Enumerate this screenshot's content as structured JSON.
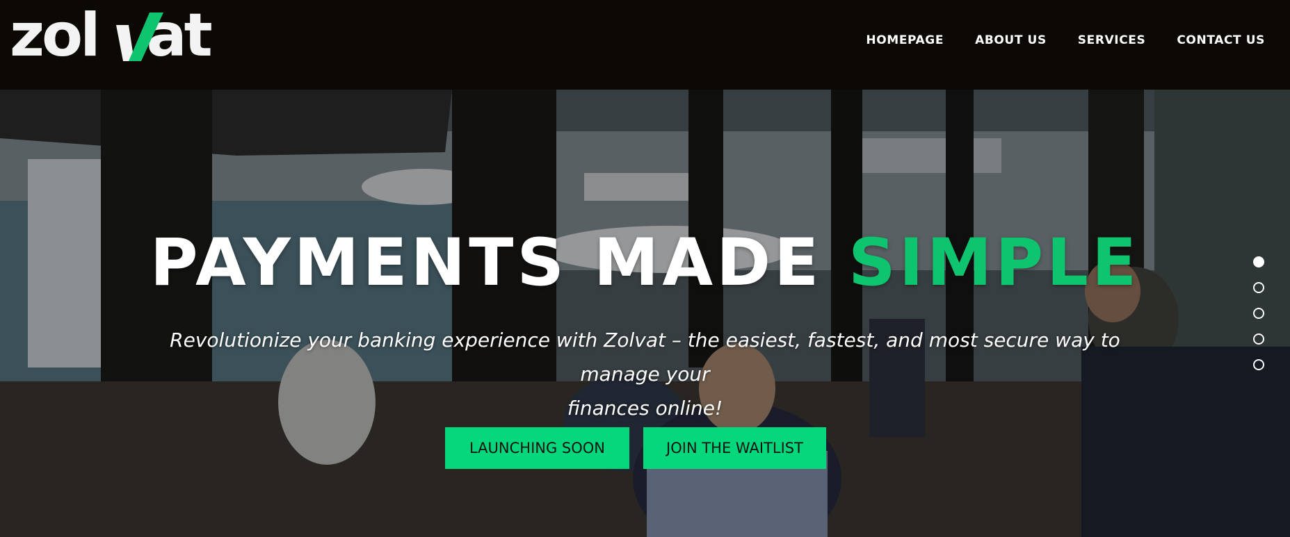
{
  "brand": {
    "logo_text_before": "zol",
    "logo_text_after": "at",
    "logo_v_color": "#0fc46f"
  },
  "nav": {
    "items": [
      {
        "label": "HOMEPAGE"
      },
      {
        "label": "ABOUT US"
      },
      {
        "label": "SERVICES"
      },
      {
        "label": "CONTACT US"
      }
    ]
  },
  "hero": {
    "headline_main": "PAYMENTS MADE",
    "headline_accent": "SIMPLE",
    "subtitle_line1": "Revolutionize your banking experience with Zolvat – the easiest, fastest, and most secure way to manage your",
    "subtitle_line2": "finances online!",
    "buttons": {
      "primary": "LAUNCHING SOON",
      "secondary": "JOIN THE WAITLIST"
    },
    "slider": {
      "count": 5,
      "active_index": 0
    }
  },
  "colors": {
    "accent": "#0fc46f",
    "button": "#05d77d",
    "header_bg": "#0c0904"
  }
}
